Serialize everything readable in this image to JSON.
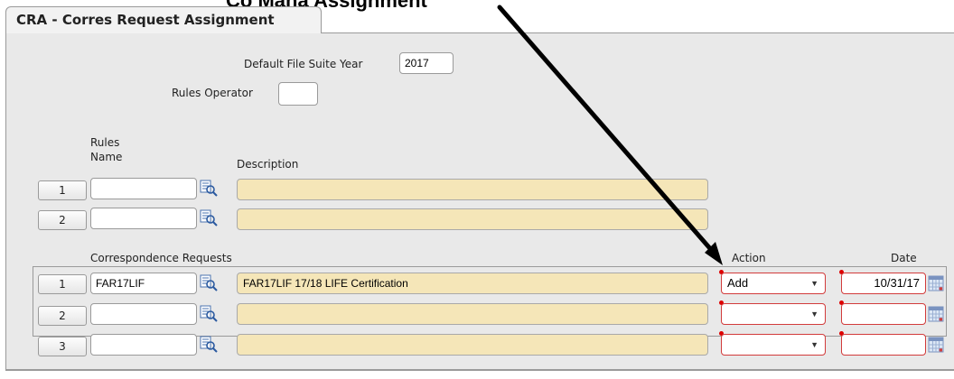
{
  "header": {
    "cropped_title": "Co   Mana   Assignment"
  },
  "tab": {
    "title": "CRA - Corres Request Assignment"
  },
  "form": {
    "default_file_suite_year_label": "Default File Suite Year",
    "default_file_suite_year_value": "2017",
    "rules_operator_label": "Rules Operator",
    "rules_operator_value": ""
  },
  "rules": {
    "name_header_line1": "Rules",
    "name_header_line2": "Name",
    "description_header": "Description",
    "rows": [
      {
        "num": "1",
        "name": "",
        "description": ""
      },
      {
        "num": "2",
        "name": "",
        "description": ""
      }
    ]
  },
  "correspondence": {
    "header": "Correspondence Requests",
    "action_header": "Action",
    "date_header": "Date",
    "rows": [
      {
        "num": "1",
        "name": "FAR17LIF",
        "description": "FAR17LIF 17/18 LIFE Certification",
        "action": "Add",
        "date": "10/31/17"
      },
      {
        "num": "2",
        "name": "",
        "description": "",
        "action": "",
        "date": ""
      },
      {
        "num": "3",
        "name": "",
        "description": "",
        "action": "",
        "date": ""
      }
    ]
  },
  "icons": {
    "lookup": "search-list-icon",
    "dropdown": "chevron-down-icon",
    "calendar": "calendar-icon",
    "annotation": "arrow-annotation"
  },
  "colors": {
    "panel": "#e9e9e9",
    "description_fill": "#f5e6b8",
    "required_border": "#d23b3b",
    "arrow": "#000000"
  }
}
